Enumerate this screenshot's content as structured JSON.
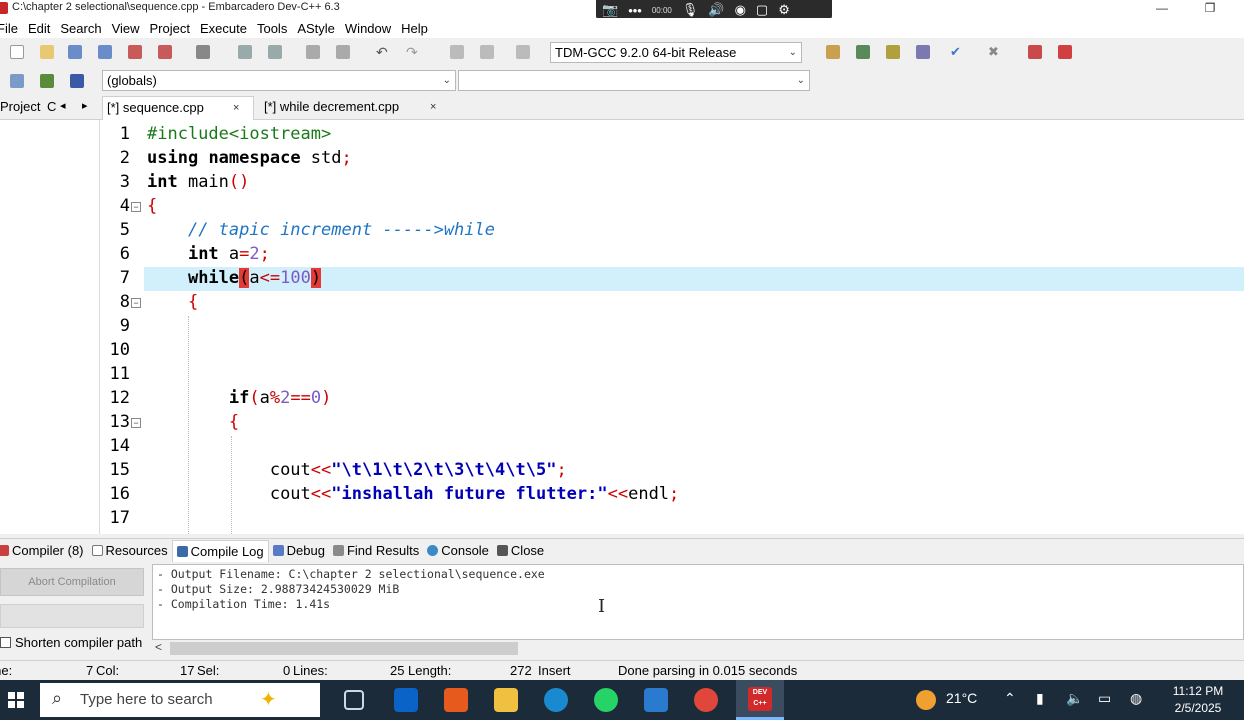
{
  "window": {
    "title": "C:\\chapter 2 selectional\\sequence.cpp - Embarcadero Dev-C++ 6.3",
    "minimize": "—",
    "restore": "❐"
  },
  "overlay": {
    "time": "00:00"
  },
  "menu": [
    "File",
    "Edit",
    "Search",
    "View",
    "Project",
    "Execute",
    "Tools",
    "AStyle",
    "Window",
    "Help"
  ],
  "toolbar": {
    "compiler": "TDM-GCC 9.2.0 64-bit Release",
    "scope": "(globals)",
    "scope2": ""
  },
  "tabs": {
    "project_label": "Project",
    "class_label": "C",
    "nav_prev": "◂",
    "nav_next": "▸",
    "files": [
      {
        "label": "[*] sequence.cpp",
        "close": "×"
      },
      {
        "label": "[*] while decrement.cpp",
        "close": "×"
      }
    ]
  },
  "editor": {
    "current_line": 7,
    "lines": [
      {
        "n": "1"
      },
      {
        "n": "2"
      },
      {
        "n": "3"
      },
      {
        "n": "4"
      },
      {
        "n": "5"
      },
      {
        "n": "6"
      },
      {
        "n": "7"
      },
      {
        "n": "8"
      },
      {
        "n": "9"
      },
      {
        "n": "10"
      },
      {
        "n": "11"
      },
      {
        "n": "12"
      },
      {
        "n": "13"
      },
      {
        "n": "14"
      },
      {
        "n": "15"
      },
      {
        "n": "16"
      },
      {
        "n": "17"
      }
    ],
    "code": {
      "l1": "#include<iostream>",
      "l2_kw1": "using",
      "l2_kw2": "namespace",
      "l2_rest": " std",
      "l2_semi": ";",
      "l3_kw": "int",
      "l3_rest": " main",
      "l3_paren": "()",
      "l4": "{",
      "l5": "// tapic increment ----->while",
      "l6_kw": "int",
      "l6_var": " a",
      "l6_eq": "=",
      "l6_num": "2",
      "l6_semi": ";",
      "l7_kw": "while",
      "l7_open": "(",
      "l7_var": "a",
      "l7_op": "<=",
      "l7_num": "100",
      "l7_close": ")",
      "l8": "{",
      "l12_kw": "if",
      "l12_open": "(",
      "l12_var": "a",
      "l12_op": "%",
      "l12_num1": "2",
      "l12_eq": "==",
      "l12_num2": "0",
      "l12_close": ")",
      "l13": "{",
      "l15_id": "cout",
      "l15_op": "<<",
      "l15_str": "\"\\t\\1\\t\\2\\t\\3\\t\\4\\t\\5\"",
      "l15_semi": ";",
      "l16_id": "cout",
      "l16_op": "<<",
      "l16_str": "\"inshallah future flutter:\"",
      "l16_op2": "<<",
      "l16_id2": "endl",
      "l16_semi": ";"
    }
  },
  "bottom_tabs": [
    {
      "label": "Compiler (8)",
      "icon": "compiler-icon"
    },
    {
      "label": "Resources",
      "icon": "resources-icon"
    },
    {
      "label": "Compile Log",
      "icon": "compile-log-icon"
    },
    {
      "label": "Debug",
      "icon": "debug-icon"
    },
    {
      "label": "Find Results",
      "icon": "find-results-icon"
    },
    {
      "label": "Console",
      "icon": "console-icon"
    },
    {
      "label": "Close",
      "icon": "close-panel-icon"
    }
  ],
  "compile_panel": {
    "abort_label": "Abort Compilation",
    "shorten_label": "Shorten compiler path",
    "log": [
      "- Output Filename: C:\\chapter 2 selectional\\sequence.exe",
      "- Output Size: 2.98873424530029 MiB",
      "- Compilation Time: 1.41s"
    ],
    "scroll_left": "<"
  },
  "status": {
    "line_label": "Line:",
    "line_value": "7",
    "col_label": "Col:",
    "col_value": "17",
    "sel_label": "Sel:",
    "sel_value": "0",
    "lines_label": "Lines:",
    "lines_value": "25",
    "length_label": "Length:",
    "length_value": "272",
    "mode": "Insert",
    "message": "Done parsing in 0.015 seconds"
  },
  "taskbar": {
    "search_placeholder": "Type here to search",
    "temperature": "21°C",
    "time": "11:12 PM",
    "date": "2/5/2025",
    "devcpp_label": "DEV C++"
  },
  "colors": {
    "current_line_bg": "#d2f0fb",
    "brace_match": "#e53935",
    "comment": "#1f74c4",
    "string": "#0000b8",
    "number": "#7a5cc7",
    "symbol": "#cc0000",
    "taskbar": "#1c2b3a"
  }
}
